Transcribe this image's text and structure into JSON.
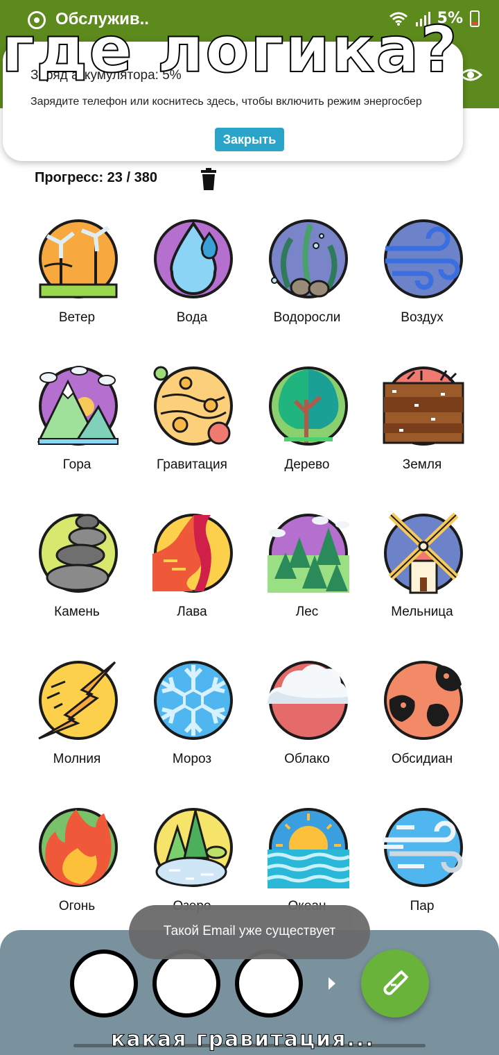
{
  "status_bar": {
    "app_title": "Обслужив..",
    "battery": "5%"
  },
  "notification": {
    "title": "Заряд аккумулятора: 5%",
    "body": "Зарядите телефон или коснитесь здесь, чтобы включить режим энергосбер",
    "close_label": "Закрыть"
  },
  "meme": {
    "top_text": "где логика?",
    "bottom_text": "какая гравитация..."
  },
  "progress": {
    "text": "Прогресс: 23 / 380",
    "current": 23,
    "total": 380
  },
  "elements": [
    {
      "label": "Ветер",
      "icon": "wind-turbine-icon"
    },
    {
      "label": "Вода",
      "icon": "water-drop-icon"
    },
    {
      "label": "Водоросли",
      "icon": "seaweed-icon"
    },
    {
      "label": "Воздух",
      "icon": "air-swirl-icon"
    },
    {
      "label": "Гора",
      "icon": "mountain-icon"
    },
    {
      "label": "Гравитация",
      "icon": "gravity-planet-icon"
    },
    {
      "label": "Дерево",
      "icon": "tree-icon"
    },
    {
      "label": "Земля",
      "icon": "earth-soil-icon"
    },
    {
      "label": "Камень",
      "icon": "stone-stack-icon"
    },
    {
      "label": "Лава",
      "icon": "lava-icon"
    },
    {
      "label": "Лес",
      "icon": "forest-icon"
    },
    {
      "label": "Мельница",
      "icon": "windmill-icon"
    },
    {
      "label": "Молния",
      "icon": "lightning-icon"
    },
    {
      "label": "Мороз",
      "icon": "snowflake-icon"
    },
    {
      "label": "Облако",
      "icon": "cloud-icon"
    },
    {
      "label": "Обсидиан",
      "icon": "obsidian-icon"
    },
    {
      "label": "Огонь",
      "icon": "fire-icon"
    },
    {
      "label": "Озеро",
      "icon": "lake-icon"
    },
    {
      "label": "Океан",
      "icon": "ocean-icon"
    },
    {
      "label": "Пар",
      "icon": "steam-icon"
    }
  ],
  "toast": {
    "text": "Такой Email уже существует"
  },
  "colors": {
    "appbar": "#5c8a1c",
    "close_button": "#2ba4c9",
    "panel": "#7a919e",
    "fab": "#69b33a"
  }
}
